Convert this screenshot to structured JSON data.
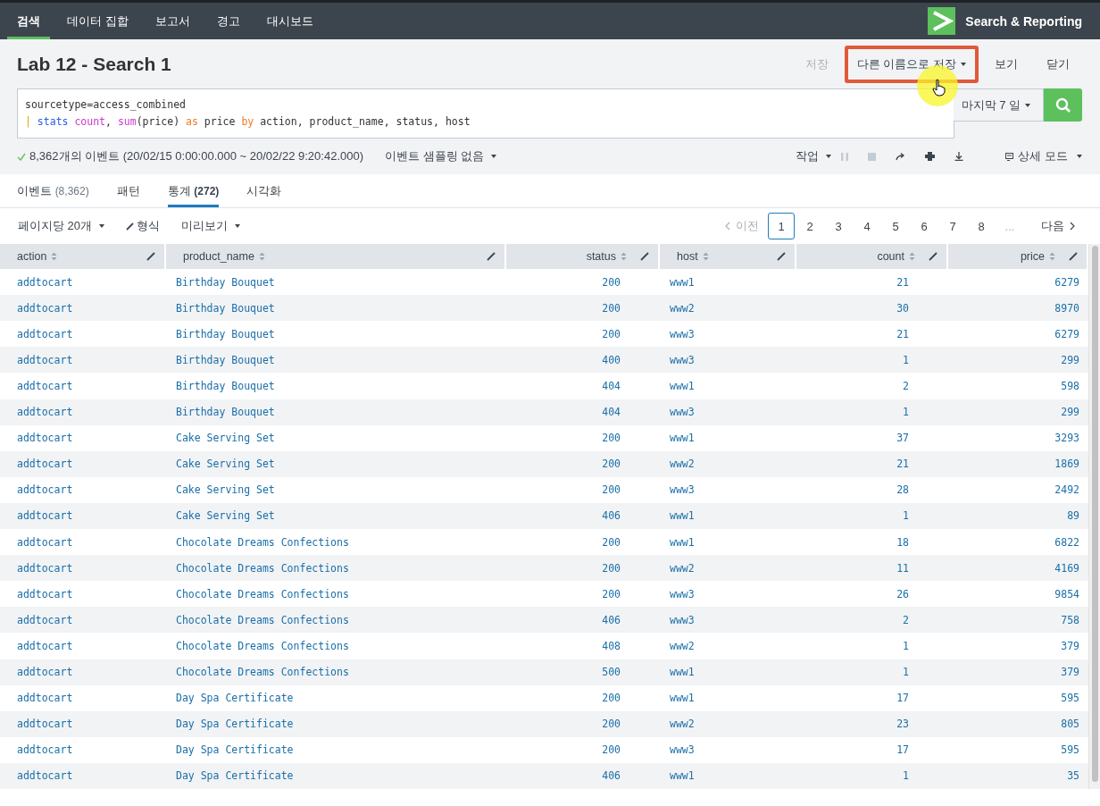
{
  "nav": {
    "tabs": [
      {
        "label": "검색",
        "selected": true
      },
      {
        "label": "데이터 집합",
        "selected": false
      },
      {
        "label": "보고서",
        "selected": false
      },
      {
        "label": "경고",
        "selected": false
      },
      {
        "label": "대시보드",
        "selected": false
      }
    ],
    "app_name": "Search & Reporting"
  },
  "title": "Lab 12 - Search 1",
  "actions": [
    {
      "label": "저장",
      "disabled": true,
      "dropdown": false,
      "highlighted": false
    },
    {
      "label": "다른 이름으로 저장",
      "disabled": false,
      "dropdown": true,
      "highlighted": true
    },
    {
      "label": "보기",
      "disabled": false,
      "dropdown": false,
      "highlighted": false
    },
    {
      "label": "닫기",
      "disabled": false,
      "dropdown": false,
      "highlighted": false
    }
  ],
  "query": {
    "lines": [
      [
        {
          "text": "sourcetype=access_combined",
          "kind": "plain"
        }
      ],
      [
        {
          "text": "|",
          "kind": "pipe"
        },
        {
          "text": " stats ",
          "kind": "command"
        },
        {
          "text": "count",
          "kind": "function"
        },
        {
          "text": ", ",
          "kind": "plain"
        },
        {
          "text": "sum",
          "kind": "function"
        },
        {
          "text": "(price) ",
          "kind": "plain"
        },
        {
          "text": "as",
          "kind": "keyword"
        },
        {
          "text": " price ",
          "kind": "plain"
        },
        {
          "text": "by",
          "kind": "keyword"
        },
        {
          "text": " action, product_name, status, host",
          "kind": "plain"
        }
      ]
    ],
    "time_range": "마지막 7 일"
  },
  "status": {
    "summary": "8,362개의 이벤트 (20/02/15 0:00:00.000 ~ 20/02/22 9:20:42.000)",
    "sampling": "이벤트 샘플링 없음",
    "job": "작업",
    "mode": "상세 모드"
  },
  "result_tabs": [
    {
      "label": "이벤트",
      "count": "(8,362)",
      "selected": false
    },
    {
      "label": "패턴",
      "selected": false
    },
    {
      "label": "통계",
      "count": "(272)",
      "selected": true
    },
    {
      "label": "시각화",
      "selected": false
    }
  ],
  "table_toolbar": {
    "per_page": "페이지당 20개",
    "format": "형식",
    "preview": "미리보기"
  },
  "pagination": {
    "prev": "이전",
    "prev_disabled": true,
    "pages": [
      {
        "label": "1",
        "selected": true
      },
      {
        "label": "2",
        "selected": false
      },
      {
        "label": "3",
        "selected": false
      },
      {
        "label": "4",
        "selected": false
      },
      {
        "label": "5",
        "selected": false
      },
      {
        "label": "6",
        "selected": false
      },
      {
        "label": "7",
        "selected": false
      },
      {
        "label": "8",
        "selected": false
      }
    ],
    "ellipsis": "...",
    "next": "다음"
  },
  "table": {
    "columns": [
      {
        "label": "action",
        "kind": "text"
      },
      {
        "label": "product_name",
        "kind": "text"
      },
      {
        "label": "status",
        "kind": "number"
      },
      {
        "label": "host",
        "kind": "text"
      },
      {
        "label": "count",
        "kind": "number"
      },
      {
        "label": "price",
        "kind": "number"
      }
    ],
    "rows": [
      [
        "addtocart",
        "Birthday Bouquet",
        "200",
        "www1",
        "21",
        "6279"
      ],
      [
        "addtocart",
        "Birthday Bouquet",
        "200",
        "www2",
        "30",
        "8970"
      ],
      [
        "addtocart",
        "Birthday Bouquet",
        "200",
        "www3",
        "21",
        "6279"
      ],
      [
        "addtocart",
        "Birthday Bouquet",
        "400",
        "www3",
        "1",
        "299"
      ],
      [
        "addtocart",
        "Birthday Bouquet",
        "404",
        "www1",
        "2",
        "598"
      ],
      [
        "addtocart",
        "Birthday Bouquet",
        "404",
        "www3",
        "1",
        "299"
      ],
      [
        "addtocart",
        "Cake Serving Set",
        "200",
        "www1",
        "37",
        "3293"
      ],
      [
        "addtocart",
        "Cake Serving Set",
        "200",
        "www2",
        "21",
        "1869"
      ],
      [
        "addtocart",
        "Cake Serving Set",
        "200",
        "www3",
        "28",
        "2492"
      ],
      [
        "addtocart",
        "Cake Serving Set",
        "406",
        "www1",
        "1",
        "89"
      ],
      [
        "addtocart",
        "Chocolate Dreams Confections",
        "200",
        "www1",
        "18",
        "6822"
      ],
      [
        "addtocart",
        "Chocolate Dreams Confections",
        "200",
        "www2",
        "11",
        "4169"
      ],
      [
        "addtocart",
        "Chocolate Dreams Confections",
        "200",
        "www3",
        "26",
        "9854"
      ],
      [
        "addtocart",
        "Chocolate Dreams Confections",
        "406",
        "www3",
        "2",
        "758"
      ],
      [
        "addtocart",
        "Chocolate Dreams Confections",
        "408",
        "www2",
        "1",
        "379"
      ],
      [
        "addtocart",
        "Chocolate Dreams Confections",
        "500",
        "www1",
        "1",
        "379"
      ],
      [
        "addtocart",
        "Day Spa Certificate",
        "200",
        "www1",
        "17",
        "595"
      ],
      [
        "addtocart",
        "Day Spa Certificate",
        "200",
        "www2",
        "23",
        "805"
      ],
      [
        "addtocart",
        "Day Spa Certificate",
        "200",
        "www3",
        "17",
        "595"
      ],
      [
        "addtocart",
        "Day Spa Certificate",
        "406",
        "www1",
        "1",
        "35"
      ]
    ]
  }
}
